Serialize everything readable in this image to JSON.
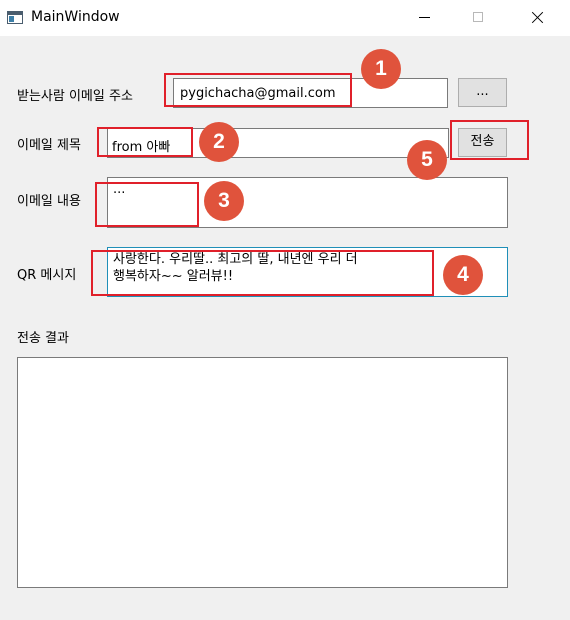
{
  "window": {
    "title": "MainWindow"
  },
  "form": {
    "recipient_label": "받는사람 이메일 주소",
    "recipient_value": "pygichacha@gmail.com",
    "browse_label": "...",
    "subject_label": "이메일 제목",
    "subject_value": "from 아빠",
    "send_label": "전송",
    "body_label": "이메일 내용",
    "body_value": "...",
    "qr_label": "QR 메시지",
    "qr_value_line1": "사랑한다. 우리딸.. 최고의 딸, 내년엔 우리 더",
    "qr_value_line2": "행복하자~~ 알러뷰!!",
    "result_label": "전송 결과",
    "result_value": ""
  },
  "annotations": [
    "1",
    "2",
    "3",
    "4",
    "5"
  ],
  "colors": {
    "highlight": "#e0202a",
    "badge": "#e0533c",
    "qr_border": "#1f8fb8"
  }
}
